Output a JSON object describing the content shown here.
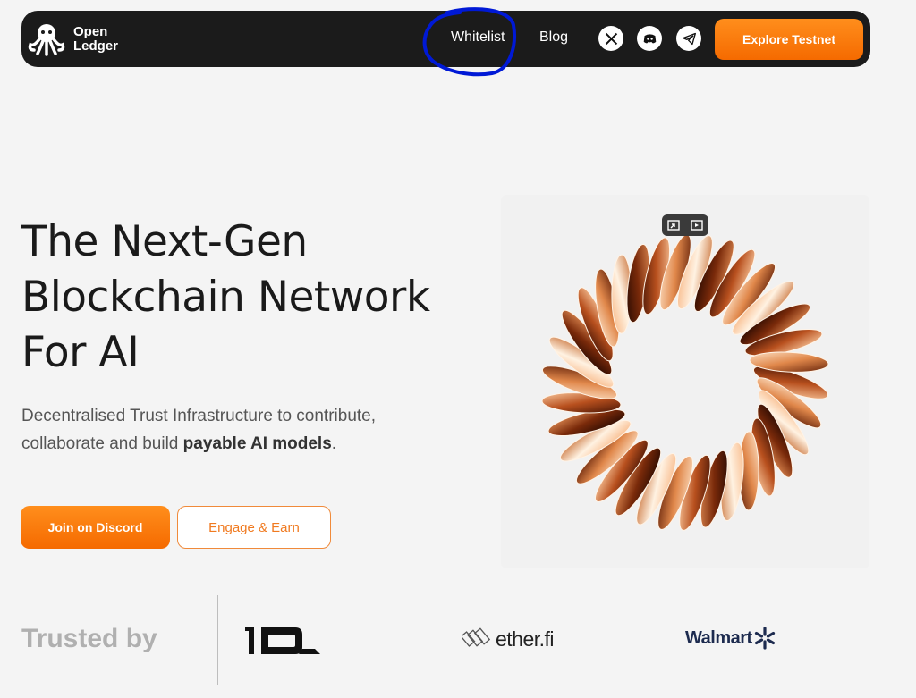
{
  "navbar": {
    "brand_line1": "Open",
    "brand_line2": "Ledger",
    "links": [
      {
        "label": "Whitelist"
      },
      {
        "label": "Blog"
      }
    ],
    "social_icons": [
      "x-icon",
      "discord-icon",
      "telegram-icon"
    ],
    "cta_label": "Explore Testnet"
  },
  "hero": {
    "title_line1": "The Next-Gen",
    "title_line2": "Blockchain Network",
    "title_line3": "For AI",
    "desc_part1": "Decentralised Trust Infrastructure to contribute, collaborate and build ",
    "desc_bold": "payable AI models",
    "desc_end": ".",
    "primary_button": "Join on Discord",
    "secondary_button": "Engage & Earn"
  },
  "trusted": {
    "label": "Trusted by",
    "logos": {
      "etherfi": "ether.fi",
      "walmart": "Walmart"
    }
  },
  "colors": {
    "accent": "#f57a0c",
    "navbar_bg": "#1b1b1b",
    "page_bg": "#f4f4f4",
    "annotation": "#0019d6"
  }
}
